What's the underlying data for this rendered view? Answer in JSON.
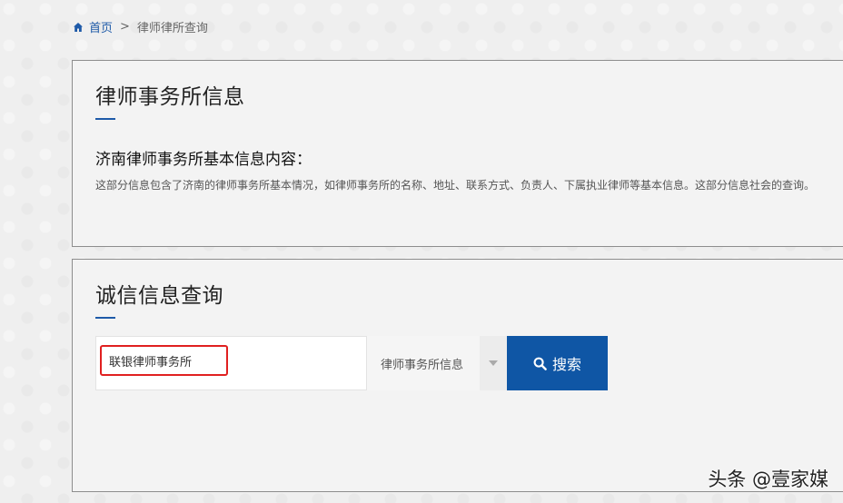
{
  "breadcrumb": {
    "home_label": "首页",
    "separator": ">",
    "current": "律师律所查询"
  },
  "info_panel": {
    "title": "律师事务所信息",
    "subheading": "济南律师事务所基本信息内容：",
    "description": "这部分信息包含了济南的律师事务所基本情况，如律师事务所的名称、地址、联系方式、负责人、下属执业律师等基本信息。这部分信息社会的查询。"
  },
  "search_panel": {
    "title": "诚信信息查询",
    "input_value": "联银律师事务所",
    "select_value": "律师事务所信息",
    "button_label": "搜索"
  },
  "watermark": "头条 @壹家媒",
  "colors": {
    "accent": "#0f56a5",
    "highlight_border": "#e02020",
    "link": "#1e5aa8"
  }
}
